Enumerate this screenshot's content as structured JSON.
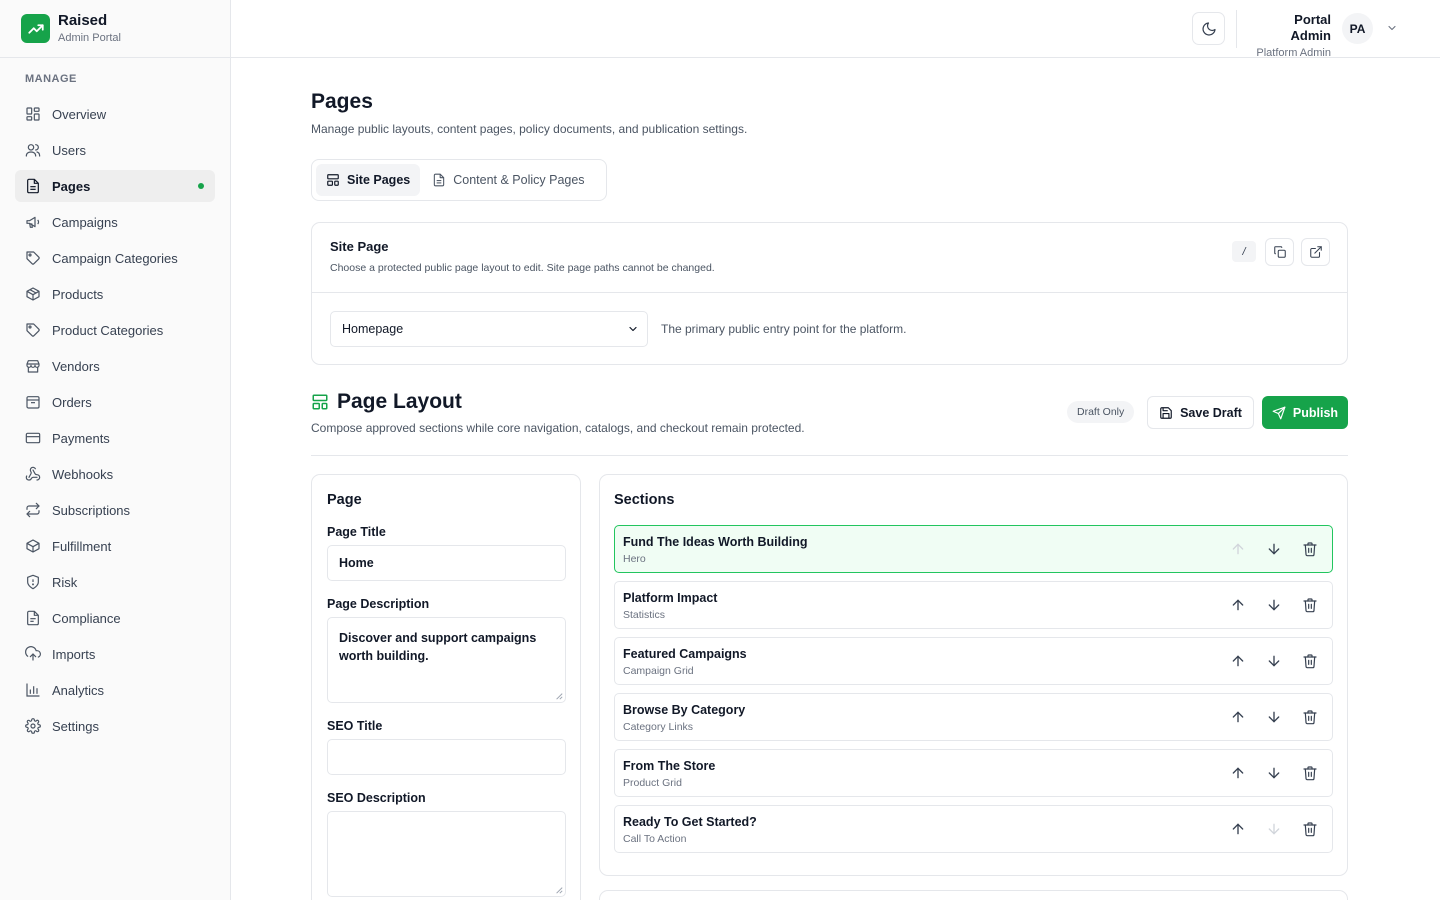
{
  "brand": {
    "name": "Raised",
    "subtitle": "Admin Portal"
  },
  "sidebar": {
    "section_label": "MANAGE",
    "items": [
      {
        "label": "Overview",
        "icon": "overview-icon"
      },
      {
        "label": "Users",
        "icon": "users-icon"
      },
      {
        "label": "Pages",
        "icon": "pages-icon",
        "active": true
      },
      {
        "label": "Campaigns",
        "icon": "megaphone-icon"
      },
      {
        "label": "Campaign Categories",
        "icon": "tag-icon"
      },
      {
        "label": "Products",
        "icon": "box-icon"
      },
      {
        "label": "Product Categories",
        "icon": "tag-icon"
      },
      {
        "label": "Vendors",
        "icon": "store-icon"
      },
      {
        "label": "Orders",
        "icon": "package-icon"
      },
      {
        "label": "Payments",
        "icon": "credit-card-icon"
      },
      {
        "label": "Webhooks",
        "icon": "webhook-icon"
      },
      {
        "label": "Subscriptions",
        "icon": "repeat-icon"
      },
      {
        "label": "Fulfillment",
        "icon": "box-icon"
      },
      {
        "label": "Risk",
        "icon": "shield-icon"
      },
      {
        "label": "Compliance",
        "icon": "file-icon"
      },
      {
        "label": "Imports",
        "icon": "upload-cloud-icon"
      },
      {
        "label": "Analytics",
        "icon": "bar-chart-icon"
      },
      {
        "label": "Settings",
        "icon": "gear-icon"
      }
    ]
  },
  "header": {
    "user_name": "Portal Admin",
    "user_role": "Platform Admin",
    "avatar_initials": "PA"
  },
  "main": {
    "title": "Pages",
    "subtitle": "Manage public layouts, content pages, policy documents, and publication settings.",
    "tabs": [
      {
        "label": "Site Pages",
        "active": true
      },
      {
        "label": "Content & Policy Pages",
        "active": false
      }
    ],
    "site_page": {
      "title": "Site Page",
      "subtitle": "Choose a protected public page layout to edit. Site page paths cannot be changed.",
      "path": "/",
      "selected": "Homepage",
      "hint": "The primary public entry point for the platform."
    },
    "layout": {
      "title": "Page Layout",
      "subtitle": "Compose approved sections while core navigation, catalogs, and checkout remain protected.",
      "status": "Draft Only",
      "save_label": "Save Draft",
      "publish_label": "Publish"
    },
    "page_form": {
      "title": "Page",
      "page_title_label": "Page Title",
      "page_title_value": "Home",
      "page_description_label": "Page Description",
      "page_description_value": "Discover and support campaigns worth building.",
      "seo_title_label": "SEO Title",
      "seo_title_value": "",
      "seo_description_label": "SEO Description",
      "seo_description_value": ""
    },
    "sections": {
      "title": "Sections",
      "items": [
        {
          "name": "Fund The Ideas Worth Building",
          "type": "Hero"
        },
        {
          "name": "Platform Impact",
          "type": "Statistics"
        },
        {
          "name": "Featured Campaigns",
          "type": "Campaign Grid"
        },
        {
          "name": "Browse By Category",
          "type": "Category Links"
        },
        {
          "name": "From The Store",
          "type": "Product Grid"
        },
        {
          "name": "Ready To Get Started?",
          "type": "Call To Action"
        }
      ]
    }
  },
  "colors": {
    "accent": "#16a34a",
    "active_row_bg": "#f0fdf4",
    "border": "#e5e7eb"
  }
}
